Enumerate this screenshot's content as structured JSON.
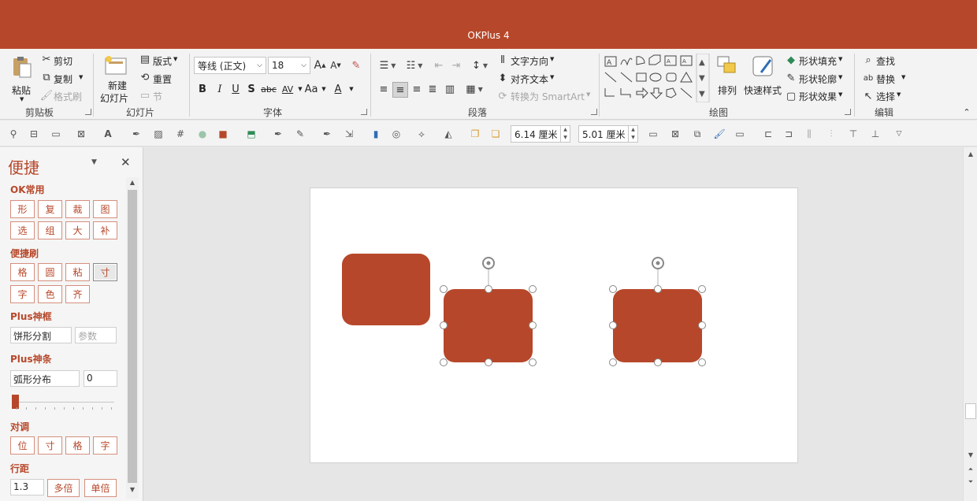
{
  "app": {
    "title": "OKPlus 4",
    "accent": "#b7472a"
  },
  "ribbon": {
    "clipboard": {
      "paste": "粘贴",
      "cut": "剪切",
      "copy": "复制",
      "format_painter": "格式刷",
      "label": "剪贴板"
    },
    "slides": {
      "new_slide_line1": "新建",
      "new_slide_line2": "幻灯片",
      "layout": "版式",
      "reset": "重置",
      "section": "节",
      "label": "幻灯片"
    },
    "font": {
      "name": "等线 (正文)",
      "size": "18",
      "bold": "B",
      "italic": "I",
      "underline": "U",
      "shadow": "S",
      "strike": "abc",
      "spacing": "AV",
      "case": "Aa",
      "color": "A",
      "label": "字体"
    },
    "paragraph": {
      "text_direction": "文字方向",
      "align_text": "对齐文本",
      "convert_smartart": "转换为 SmartArt",
      "label": "段落"
    },
    "drawing": {
      "arrange": "排列",
      "quick_styles": "快速样式",
      "shape_fill": "形状填充",
      "shape_outline": "形状轮廓",
      "shape_effects": "形状效果",
      "label": "绘图"
    },
    "editing": {
      "find": "查找",
      "replace": "替换",
      "select": "选择",
      "label": "编辑"
    }
  },
  "toolbar2": {
    "width_value": "6.14 厘米",
    "height_value": "5.01 厘米"
  },
  "panel": {
    "title": "便捷",
    "sections": {
      "ok_common": {
        "title": "OK常用",
        "buttons": [
          "形",
          "复",
          "裁",
          "图",
          "选",
          "组",
          "大",
          "补"
        ]
      },
      "brush": {
        "title": "便捷刷",
        "buttons": [
          "格",
          "圆",
          "粘",
          "寸",
          "字",
          "色",
          "齐"
        ]
      },
      "plus_frame": {
        "title": "Plus神框",
        "input": "饼形分割",
        "param_placeholder": "参数"
      },
      "plus_bar": {
        "title": "Plus神条",
        "input": "弧形分布",
        "value": "0"
      },
      "align": {
        "title": "对调",
        "buttons": [
          "位",
          "寸",
          "格",
          "字"
        ]
      },
      "line_spacing": {
        "title": "行距",
        "value": "1.3",
        "multi": "多倍",
        "single": "单倍"
      }
    }
  },
  "slide": {
    "shape_color": "#b7472a"
  }
}
